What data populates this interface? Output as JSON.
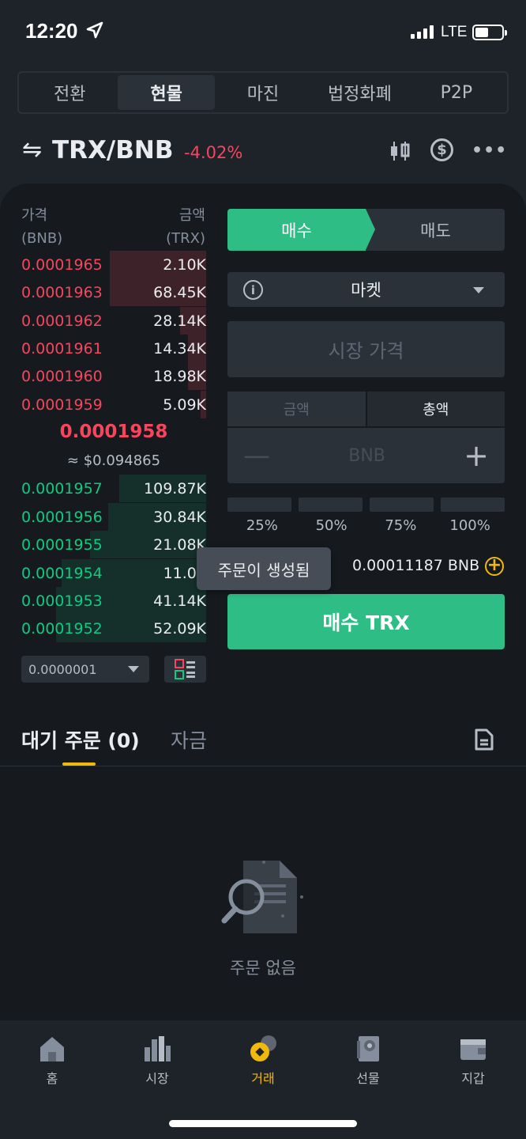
{
  "status_bar": {
    "time": "12:20",
    "network": "LTE"
  },
  "mode_tabs": [
    "전환",
    "현물",
    "마진",
    "법정화폐",
    "P2P"
  ],
  "pair": {
    "name": "TRX/BNB",
    "change": "-4.02%",
    "swap_symbol": "⇋"
  },
  "orderbook": {
    "price_header": [
      "가격",
      "(BNB)"
    ],
    "amount_header": [
      "금액",
      "(TRX)"
    ],
    "asks": [
      {
        "price": "0.0001965",
        "amount": "2.10K",
        "depth": 0.52
      },
      {
        "price": "0.0001963",
        "amount": "68.45K",
        "depth": 0.52
      },
      {
        "price": "0.0001962",
        "amount": "28.14K",
        "depth": 0.14
      },
      {
        "price": "0.0001961",
        "amount": "14.34K",
        "depth": 0.1
      },
      {
        "price": "0.0001960",
        "amount": "18.98K",
        "depth": 0.1
      },
      {
        "price": "0.0001959",
        "amount": "5.09K",
        "depth": 0.03
      }
    ],
    "last_price": "0.0001958",
    "last_price_usd": "≈ $0.094865",
    "bids": [
      {
        "price": "0.0001957",
        "amount": "109.87K",
        "depth": 0.47
      },
      {
        "price": "0.0001956",
        "amount": "30.84K",
        "depth": 0.53
      },
      {
        "price": "0.0001955",
        "amount": "21.08K",
        "depth": 0.63
      },
      {
        "price": "0.0001954",
        "amount": "11.09",
        "depth": 0.78
      },
      {
        "price": "0.0001953",
        "amount": "41.14K",
        "depth": 0.81
      },
      {
        "price": "0.0001952",
        "amount": "52.09K",
        "depth": 0.81
      }
    ],
    "tick_size": "0.0000001"
  },
  "order_form": {
    "buy_tab": "매수",
    "sell_tab": "매도",
    "order_type": "마켓",
    "market_price_placeholder": "시장 가격",
    "amount_tabs": [
      "금액",
      "총액"
    ],
    "amount_unit": "BNB",
    "minus": "—",
    "plus": "+",
    "percentages": [
      "25%",
      "50%",
      "75%",
      "100%"
    ],
    "balance": "0.00011187 BNB",
    "buy_button": "매수 TRX"
  },
  "toast": "주문이 생성됨",
  "orders": {
    "open_orders_tab": "대기 주문 (0)",
    "funds_tab": "자금",
    "empty_text": "주문 없음"
  },
  "bottom_nav": [
    {
      "label": "홈",
      "icon": "home-icon"
    },
    {
      "label": "시장",
      "icon": "markets-icon"
    },
    {
      "label": "거래",
      "icon": "trade-icon"
    },
    {
      "label": "선물",
      "icon": "futures-icon"
    },
    {
      "label": "지갑",
      "icon": "wallet-icon"
    }
  ],
  "colors": {
    "buy": "#2ebd85",
    "sell": "#f6465d",
    "accent": "#f0b90b",
    "background": "#1e2329"
  }
}
